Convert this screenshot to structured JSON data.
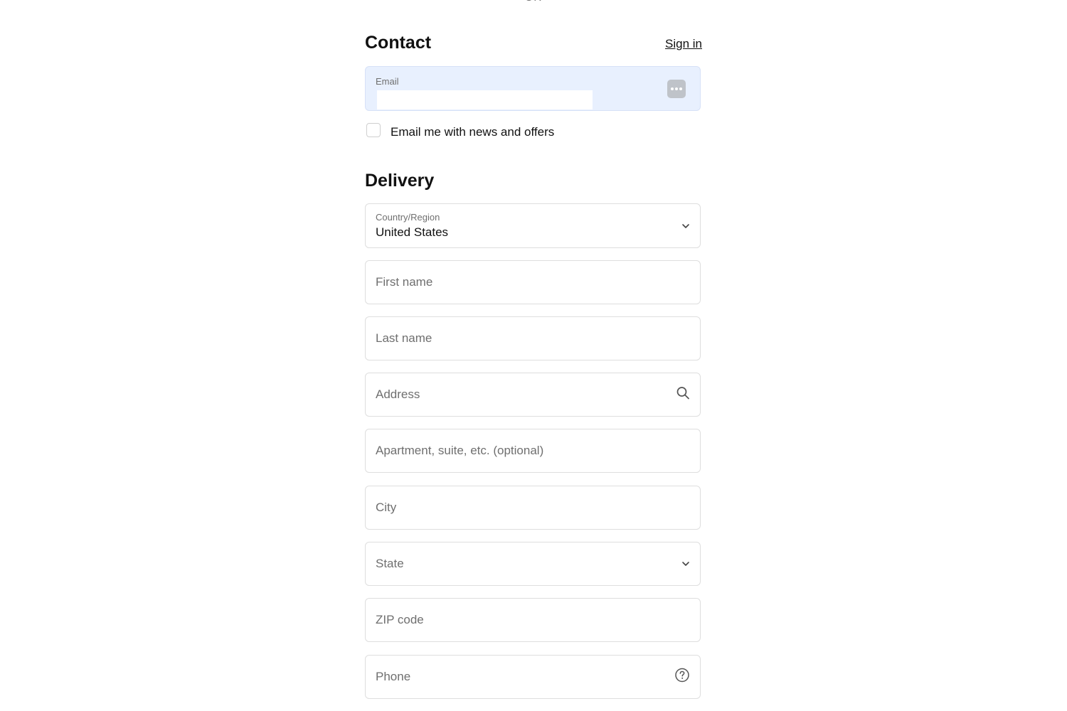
{
  "divider": {
    "text": "OR"
  },
  "contact": {
    "title": "Contact",
    "sign_in": "Sign in",
    "email_label": "Email",
    "email_value": "",
    "newsletter_label": "Email me with news and offers",
    "newsletter_checked": false
  },
  "delivery": {
    "title": "Delivery",
    "country_label": "Country/Region",
    "country_value": "United States",
    "first_name": "First name",
    "last_name": "Last name",
    "address": "Address",
    "apartment": "Apartment, suite, etc. (optional)",
    "city": "City",
    "state": "State",
    "zip": "ZIP code",
    "phone": "Phone"
  },
  "icons": {
    "autofill": "password-autofill-icon",
    "country_chevron": "chevron-down-icon",
    "address_search": "search-icon",
    "state_chevron": "chevron-down-icon",
    "phone_help": "help-circle-icon"
  }
}
